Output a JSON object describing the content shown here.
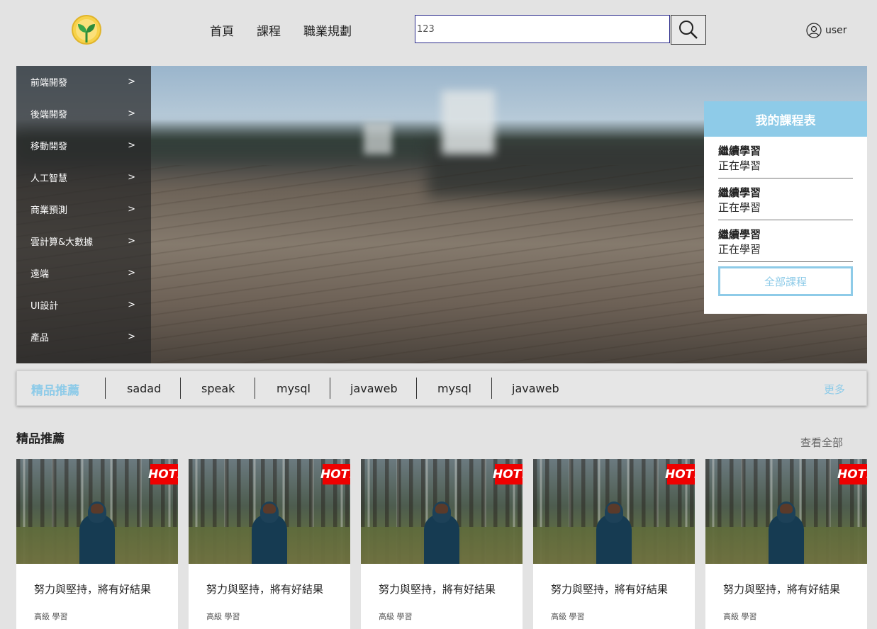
{
  "header": {
    "logo": "sprout-logo-icon",
    "nav": [
      "首頁",
      "課程",
      "職業規劃"
    ],
    "search": {
      "value": "123",
      "button_icon": "search-icon"
    },
    "user": {
      "icon": "user-icon",
      "label": "user"
    }
  },
  "sidebar": {
    "items": [
      {
        "label": "前端開發",
        "arrow": ">"
      },
      {
        "label": "後端開發",
        "arrow": ">"
      },
      {
        "label": "移動開發",
        "arrow": ">"
      },
      {
        "label": "人工智慧",
        "arrow": ">"
      },
      {
        "label": "商業預測",
        "arrow": ">"
      },
      {
        "label": "雲計算&大數據",
        "arrow": ">"
      },
      {
        "label": "遠端",
        "arrow": ">"
      },
      {
        "label": "UI設計",
        "arrow": ">"
      },
      {
        "label": "產品",
        "arrow": ">"
      }
    ]
  },
  "my_courses": {
    "title": "我的課程表",
    "items": [
      {
        "title": "繼續學習",
        "status": "正在學習"
      },
      {
        "title": "繼續學習",
        "status": "正在學習"
      },
      {
        "title": "繼續學習",
        "status": "正在學習"
      }
    ],
    "all_button": "全部課程"
  },
  "recommend_bar": {
    "title": "精品推薦",
    "links": [
      "sadad",
      "speak",
      "mysql",
      "javaweb",
      "mysql",
      "javaweb"
    ],
    "more": "更多"
  },
  "section": {
    "title": "精品推薦",
    "view_all": "查看全部"
  },
  "cards": [
    {
      "badge": "HOT!",
      "title": "努力與堅持，將有好結果",
      "level": "高級 學習"
    },
    {
      "badge": "HOT!",
      "title": "努力與堅持，將有好結果",
      "level": "高級 學習"
    },
    {
      "badge": "HOT!",
      "title": "努力與堅持，將有好結果",
      "level": "高級 學習"
    },
    {
      "badge": "HOT!",
      "title": "努力與堅持，將有好結果",
      "level": "高級 學習"
    },
    {
      "badge": "HOT!",
      "title": "努力與堅持，將有好結果",
      "level": "高級 學習"
    }
  ],
  "colors": {
    "accent": "#8ecbe8",
    "hot": "#ee0000",
    "background": "#e3e3e3"
  }
}
